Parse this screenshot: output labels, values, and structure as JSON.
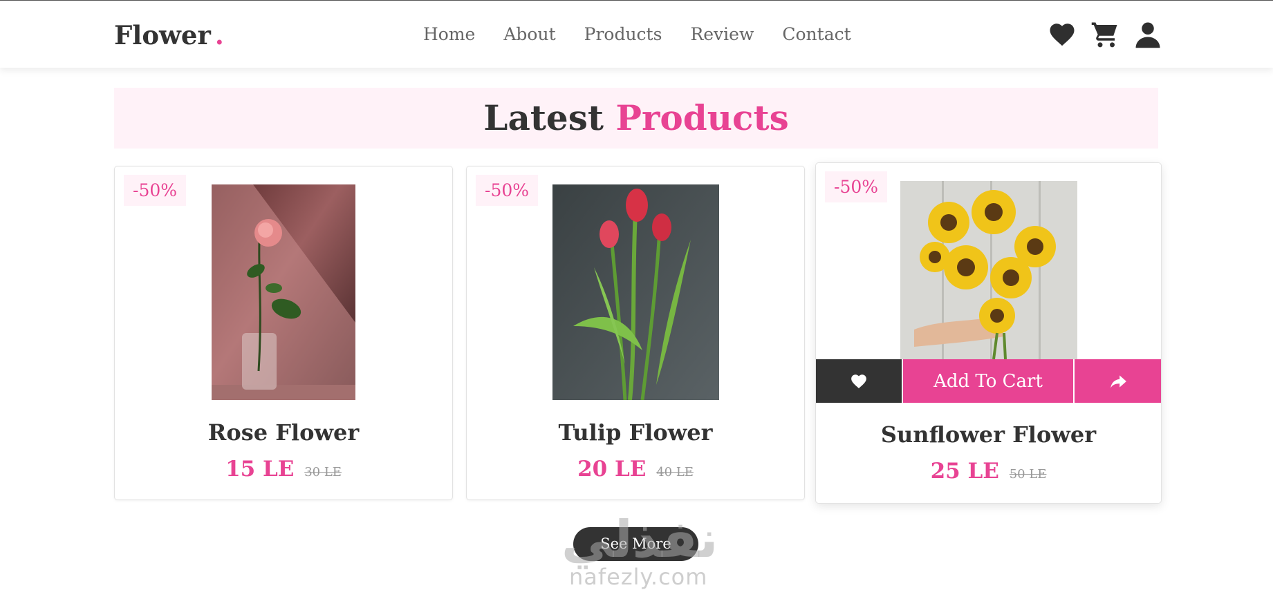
{
  "header": {
    "logo": "Flower",
    "logo_dot": ".",
    "nav": [
      "Home",
      "About",
      "Products",
      "Review",
      "Contact"
    ],
    "icons": [
      "heart-icon",
      "cart-icon",
      "user-icon"
    ]
  },
  "heading": {
    "word1": "Latest",
    "word2": "Products"
  },
  "products": [
    {
      "discount": "-50%",
      "name": "Rose Flower",
      "price": "15 LE",
      "old_price": "30 LE"
    },
    {
      "discount": "-50%",
      "name": "Tulip Flower",
      "price": "20 LE",
      "old_price": "40 LE"
    },
    {
      "discount": "-50%",
      "name": "Sunflower Flower",
      "price": "25 LE",
      "old_price": "50 LE"
    }
  ],
  "card_actions": {
    "add_to_cart": "Add To Cart"
  },
  "see_more": "See More",
  "watermark": {
    "arabic": "نفذلي",
    "latin": "nafezly.com"
  },
  "colors": {
    "accent": "#e84393",
    "dark": "#333333",
    "heading_bg": "#fff2f8"
  }
}
